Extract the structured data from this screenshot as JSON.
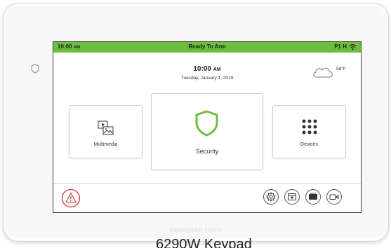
{
  "status_bar": {
    "time": "10:00",
    "time_suffix": "AM",
    "title": "Ready To Arm",
    "partition": "P1 H",
    "wifi_icon": "wifi-icon",
    "color": "#6cbf3c"
  },
  "clock": {
    "time": "10:00",
    "suffix": "AM",
    "date": "Tuesday, January 1, 2019"
  },
  "weather": {
    "icon": "cloud-icon",
    "temperature": "58°F"
  },
  "tiles": {
    "multimedia": {
      "label": "Multimedia",
      "icon": "multimedia-icon"
    },
    "security": {
      "label": "Security",
      "icon": "shield-icon",
      "accent": "#6cbf3c"
    },
    "devices": {
      "label": "Devices",
      "icon": "grid-dots-icon"
    }
  },
  "bottom_bar": {
    "alarm_icon": "warning-icon",
    "alarm_color": "#d0343a",
    "buttons": [
      "settings-icon",
      "panel-icon",
      "camera-feed-icon",
      "video-icon"
    ]
  },
  "device": {
    "brand_word1": "Honeywell",
    "brand_word2": "Home",
    "caption": "6290W Keypad"
  }
}
